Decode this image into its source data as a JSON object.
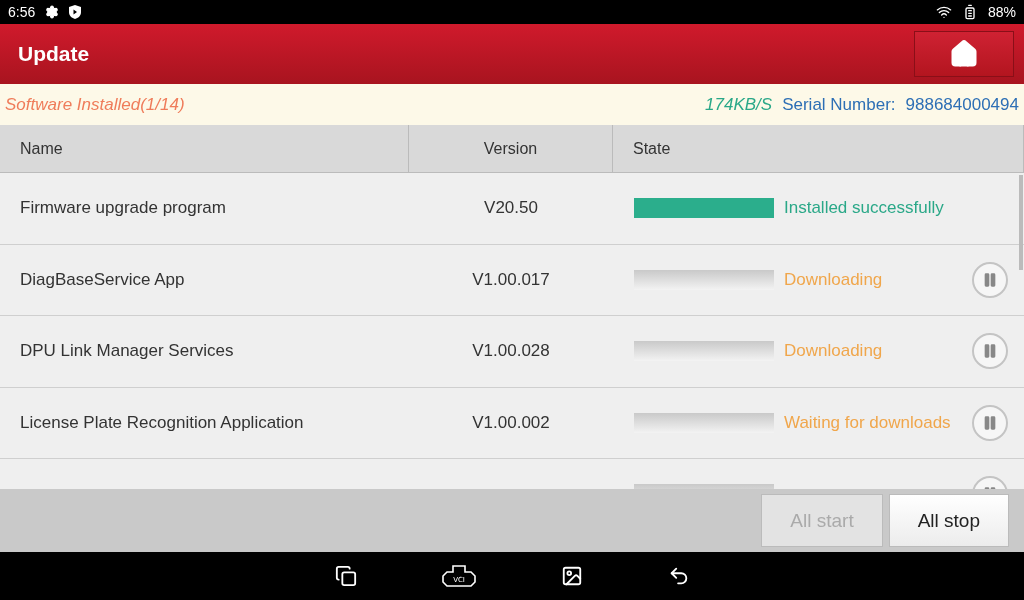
{
  "status_bar": {
    "time": "6:56",
    "battery": "88%"
  },
  "header": {
    "title": "Update"
  },
  "info_bar": {
    "summary": "Software Installed(1/14)",
    "speed": "174KB/S",
    "serial_label": "Serial Number:",
    "serial_value": "988684000494"
  },
  "table": {
    "columns": [
      "Name",
      "Version",
      "State"
    ],
    "rows": [
      {
        "name": "Firmware upgrade program",
        "version": "V20.50",
        "kind": "installed",
        "state": "Installed successfully"
      },
      {
        "name": "DiagBaseService App",
        "version": "V1.00.017",
        "kind": "pending",
        "state": "Downloading"
      },
      {
        "name": "DPU Link Manager Services",
        "version": "V1.00.028",
        "kind": "pending",
        "state": "Downloading"
      },
      {
        "name": "License Plate Recognition Application",
        "version": "V1.00.002",
        "kind": "pending",
        "state": "Waiting for downloads"
      },
      {
        "kind": "pending"
      }
    ]
  },
  "buttons": [
    {
      "label": "All start",
      "disabled": true
    },
    {
      "label": "All stop",
      "disabled": false
    }
  ],
  "nav_bar": {
    "vci_label": "VCI"
  }
}
